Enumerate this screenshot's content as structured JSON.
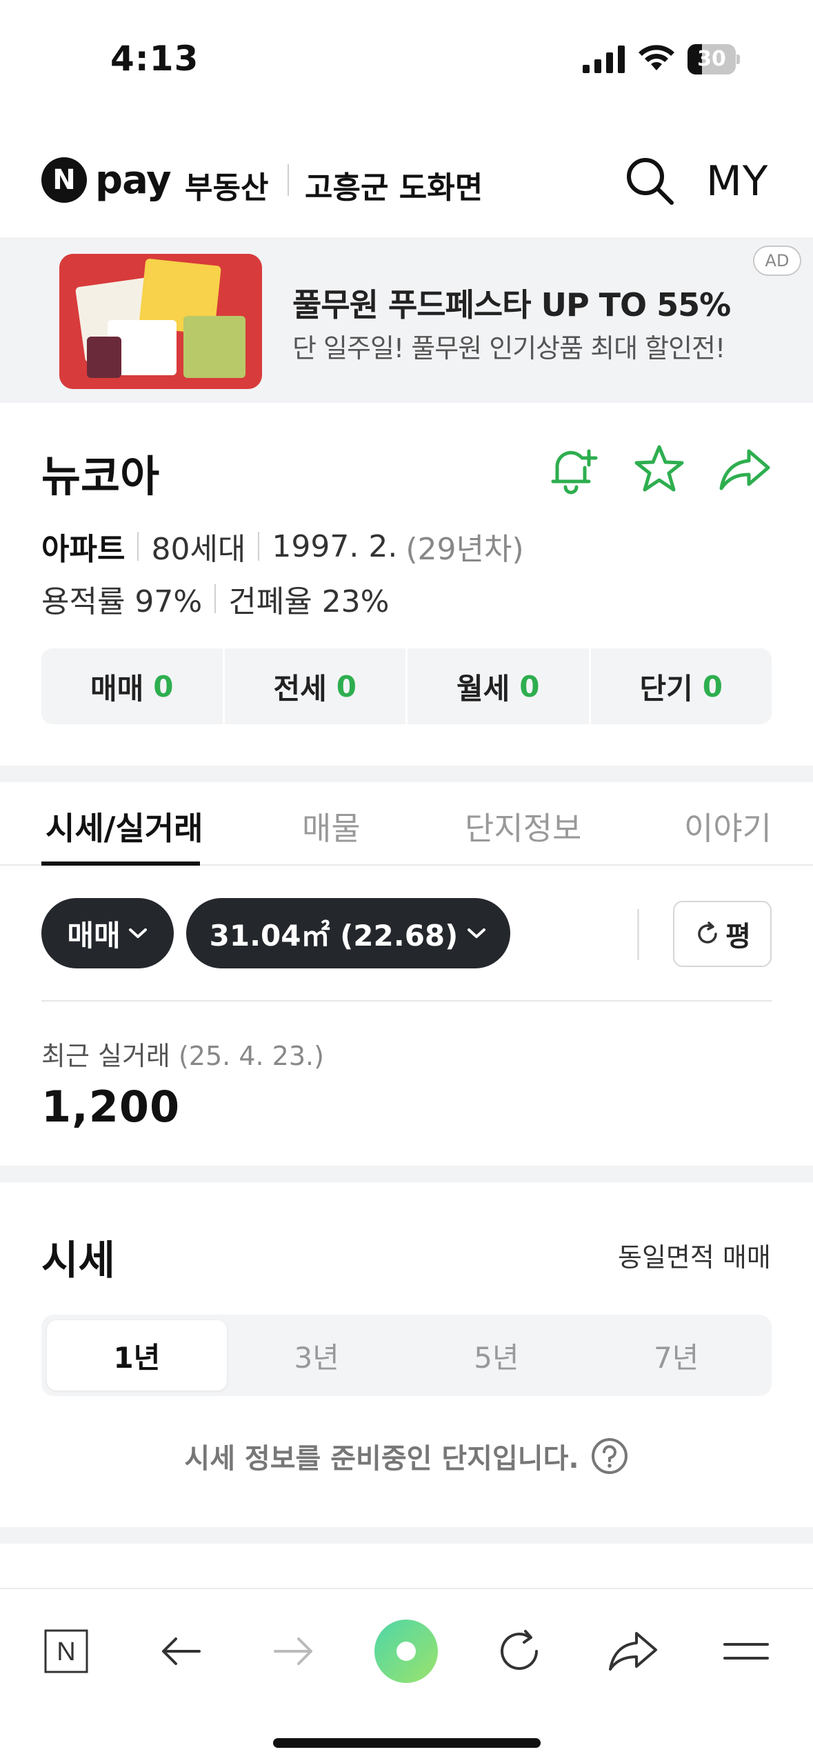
{
  "status_bar": {
    "time": "4:13",
    "battery_level": "30",
    "battery_fraction": 0.3
  },
  "header": {
    "logo_letter": "N",
    "logo_text": "pay",
    "service": "부동산",
    "region": "고흥군 도화면",
    "my_label": "MY",
    "icons": [
      "search-icon"
    ]
  },
  "ad": {
    "title": "풀무원 푸드페스타 UP TO 55%",
    "subtitle": "단 일주일! 풀무원 인기상품 최대 할인전!",
    "badge": "AD",
    "accent_color": "#d83b3b"
  },
  "complex": {
    "name": "뉴코아",
    "type": "아파트",
    "households": "80세대",
    "built": "1997. 2.",
    "age": "(29년차)",
    "floor_area_ratio": "용적률 97%",
    "coverage_ratio": "건폐율 23%",
    "actions": [
      "bell-plus-icon",
      "star-icon",
      "share-icon"
    ],
    "icon_color": "#2eae4f"
  },
  "trade_counts": [
    {
      "label": "매매",
      "count": "0"
    },
    {
      "label": "전세",
      "count": "0"
    },
    {
      "label": "월세",
      "count": "0"
    },
    {
      "label": "단기",
      "count": "0"
    }
  ],
  "tabs": [
    {
      "label": "시세/실거래",
      "active": true
    },
    {
      "label": "매물",
      "active": false
    },
    {
      "label": "단지정보",
      "active": false
    },
    {
      "label": "이야기",
      "active": false
    }
  ],
  "filters": {
    "deal_type": "매매",
    "area": "31.04㎡ (22.68)",
    "unit_toggle": "평"
  },
  "recent_deal": {
    "label": "최근 실거래",
    "date": "(25. 4. 23.)",
    "price": "1,200"
  },
  "price_section": {
    "title": "시세",
    "link": "동일면적 매매",
    "periods": [
      {
        "label": "1년",
        "active": true
      },
      {
        "label": "3년",
        "active": false
      },
      {
        "label": "5년",
        "active": false
      },
      {
        "label": "7년",
        "active": false
      }
    ],
    "notice": "시세 정보를 준비중인 단지입니다."
  },
  "toolbar": {
    "buttons": [
      "naver-home-icon",
      "back-arrow-icon",
      "forward-arrow-icon",
      "green-dot-icon",
      "reload-icon",
      "share-icon",
      "menu-icon"
    ],
    "home_letter": "N",
    "accent_gradient": [
      "#4fd6a8",
      "#9be36b"
    ]
  }
}
